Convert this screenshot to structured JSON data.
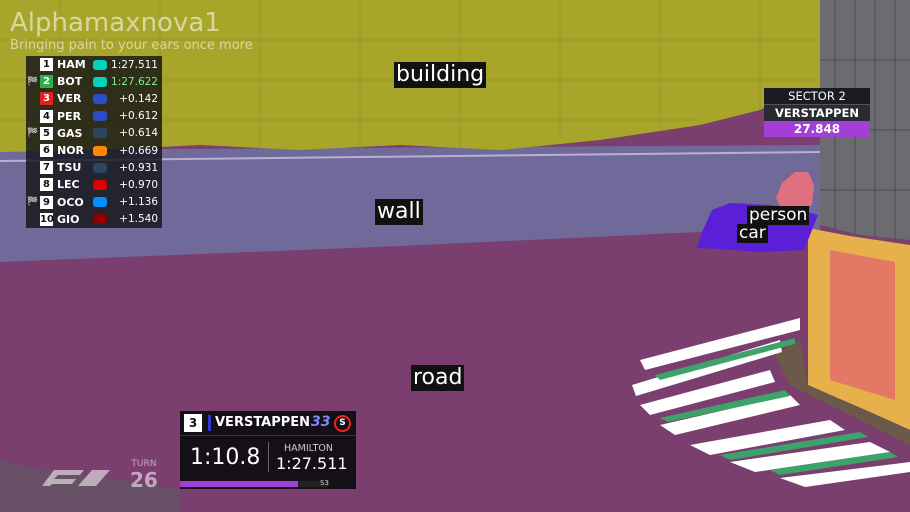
{
  "segmentation_labels": {
    "building": "building",
    "wall": "wall",
    "road": "road",
    "person": "person",
    "car": "car"
  },
  "watermark": {
    "title": "Alphamaxnova1",
    "subtitle": "Bringing pain to your ears once more"
  },
  "leaderboard": [
    {
      "pos": "1",
      "code": "HAM",
      "gap": "1:27.511",
      "flag": "",
      "team_color": "#00d2be"
    },
    {
      "pos": "2",
      "code": "BOT",
      "gap": "1:27.622",
      "flag": "🏁",
      "team_color": "#00d2be",
      "highlight": true
    },
    {
      "pos": "3",
      "code": "VER",
      "gap": "+0.142",
      "flag": "",
      "team_color": "#2b4cc7",
      "red": true
    },
    {
      "pos": "4",
      "code": "PER",
      "gap": "+0.612",
      "flag": "",
      "team_color": "#2b4cc7"
    },
    {
      "pos": "5",
      "code": "GAS",
      "gap": "+0.614",
      "flag": "🏁",
      "team_color": "#2b4562"
    },
    {
      "pos": "6",
      "code": "NOR",
      "gap": "+0.669",
      "flag": "",
      "team_color": "#ff8700"
    },
    {
      "pos": "7",
      "code": "TSU",
      "gap": "+0.931",
      "flag": "",
      "team_color": "#2b4562"
    },
    {
      "pos": "8",
      "code": "LEC",
      "gap": "+0.970",
      "flag": "",
      "team_color": "#dc0000"
    },
    {
      "pos": "9",
      "code": "OCO",
      "gap": "+1.136",
      "flag": "🏁",
      "team_color": "#0090ff"
    },
    {
      "pos": "10",
      "code": "GIO",
      "gap": "+1.540",
      "flag": "",
      "team_color": "#900000"
    }
  ],
  "sector_box": {
    "title": "SECTOR 2",
    "driver": "VERSTAPPEN",
    "time": "27.848"
  },
  "driver_box": {
    "position": "3",
    "name": "VERSTAPPEN",
    "number": "33",
    "tyre": "S",
    "lap_time": "1:10.8",
    "rival_name": "HAMILTON",
    "rival_time": "1:27.511",
    "sector_label": "S3",
    "lap_progress": 0.8
  },
  "turn": {
    "label": "TURN",
    "number": "26"
  },
  "colors": {
    "building": "#a8a62a",
    "wall": "#6f6a9a",
    "road": "#7a3f6e",
    "car": "#5a1fd6",
    "person": "#e07080",
    "sector_purple": "#a23fd6"
  }
}
